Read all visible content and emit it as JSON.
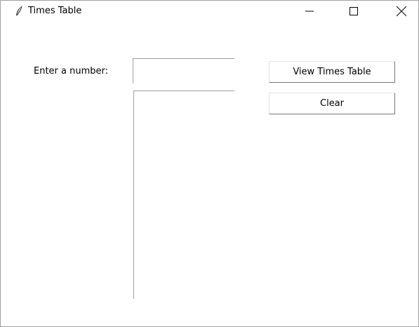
{
  "window": {
    "title": "Times Table",
    "icon": "feather-icon",
    "controls": {
      "minimize": "minimize-icon",
      "maximize": "maximize-icon",
      "close": "close-icon"
    }
  },
  "form": {
    "number_label": "Enter a number:",
    "number_value": "",
    "output_text": ""
  },
  "buttons": {
    "view_label": "View Times Table",
    "clear_label": "Clear"
  }
}
